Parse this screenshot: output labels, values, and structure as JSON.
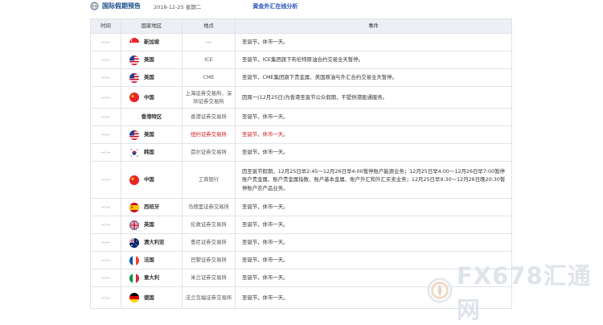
{
  "header": {
    "title": "国际假期预告",
    "date": "2018-12-25 星期二",
    "link": "黄金外汇在线分析"
  },
  "table": {
    "columns": [
      "时间",
      "国家地区",
      "地点",
      "事件"
    ],
    "rows": [
      {
        "time": "--:--",
        "country": "新加坡",
        "flag": "sg",
        "place": "---",
        "event": "圣诞节，休市一天。"
      },
      {
        "time": "--:--",
        "country": "美国",
        "flag": "us",
        "place": "ICE",
        "event": "圣诞节，ICE集团旗下布伦特原油合约交易全天暂停。"
      },
      {
        "time": "--:--",
        "country": "美国",
        "flag": "us",
        "place": "CME",
        "event": "圣诞节，CME集团旗下贵金属、美国原油与外汇合约交易全天暂停。"
      },
      {
        "time": "--:--",
        "country": "中国",
        "flag": "cn",
        "place": "上海证券交易所、深圳证券交易所",
        "event": "因周一(12月25日)为香港圣诞节公众假期，不提供港股通服务。"
      },
      {
        "time": "--:--",
        "country": "香港特区",
        "flag": "",
        "place": "香港证券交易所",
        "event": "圣诞节，休市一天。"
      },
      {
        "time": "--:--",
        "country": "美国",
        "flag": "us",
        "place": "纽约证券交易所",
        "event": "圣诞节，休市一天。",
        "highlight": true
      },
      {
        "time": "--:--",
        "country": "韩国",
        "flag": "kr",
        "place": "首尔证券交易所",
        "event": "圣诞节，休市一天。"
      },
      {
        "time": "--:--",
        "country": "中国",
        "flag": "cn",
        "place": "工商银行",
        "event": "因圣诞节假期，12月25日早2:45～12月26日早4:00暂停账户能源业务；12月25日早4:00～12月26日早7:00暂停账户贵金属、账户贵金属指数、账户基本金属、账户外汇和外汇买卖业务；12月25日早9:30～12月26日晚20:30暂停账户农产品业务。"
      },
      {
        "time": "--:--",
        "country": "西班牙",
        "flag": "es",
        "place": "马德里证券交易所",
        "event": "圣诞节，休市一天。"
      },
      {
        "time": "--:--",
        "country": "英国",
        "flag": "gb",
        "place": "伦敦证券交易所",
        "event": "圣诞节，休市一天。"
      },
      {
        "time": "--:--",
        "country": "澳大利亚",
        "flag": "au",
        "place": "悉尼证券交易所",
        "event": "圣诞节，休市一天。"
      },
      {
        "time": "--:--",
        "country": "法国",
        "flag": "fr",
        "place": "巴黎证券交易所",
        "event": "圣诞节，休市一天。"
      },
      {
        "time": "--:--",
        "country": "意大利",
        "flag": "it",
        "place": "米兰证券交易所",
        "event": "圣诞节，休市一天。"
      },
      {
        "time": "--:--",
        "country": "德国",
        "flag": "de",
        "place": "法兰克福证券交易所",
        "event": "圣诞节，休市一天。"
      }
    ]
  },
  "watermark": {
    "text": "FX678汇通网",
    "icon": "compass-logo-icon"
  },
  "colors": {
    "title": "#1a4f8a",
    "link": "#1f4fb8",
    "highlight": "#d41515",
    "header_bg": "#eceff4",
    "border": "#dfe3e8"
  }
}
